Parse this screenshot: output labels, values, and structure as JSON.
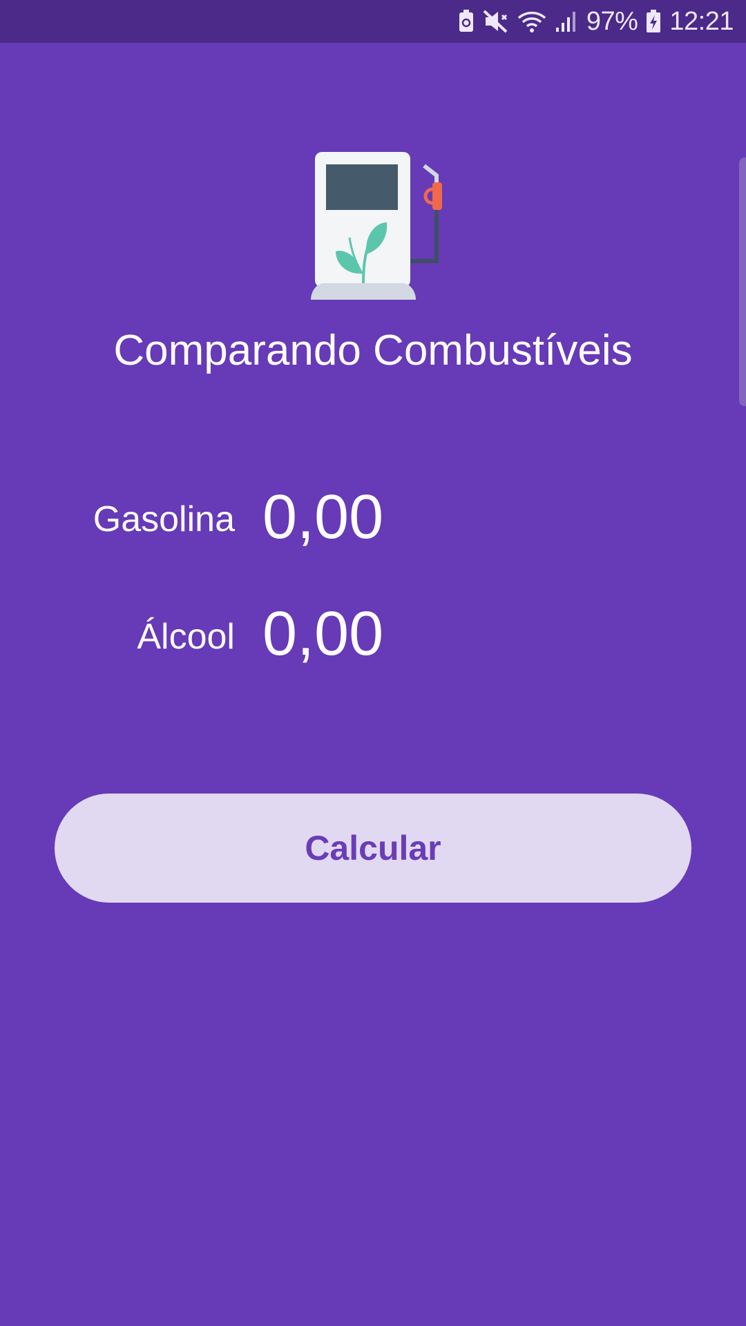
{
  "status_bar": {
    "battery_percent": "97%",
    "time": "12:21",
    "icons": [
      "battery-saver-icon",
      "mute-icon",
      "wifi-icon",
      "signal-icon",
      "battery-charging-icon"
    ]
  },
  "header": {
    "logo_icon": "fuel-pump-leaf-icon",
    "title": "Comparando Combustíveis"
  },
  "fields": [
    {
      "label": "Gasolina",
      "value": "0,00"
    },
    {
      "label": "Álcool",
      "value": "0,00"
    }
  ],
  "actions": {
    "calculate_label": "Calcular"
  },
  "colors": {
    "background": "#673ab7",
    "status_bar": "#4b2a8a",
    "button_bg": "#e1d9f2",
    "button_text": "#6a3db7"
  }
}
